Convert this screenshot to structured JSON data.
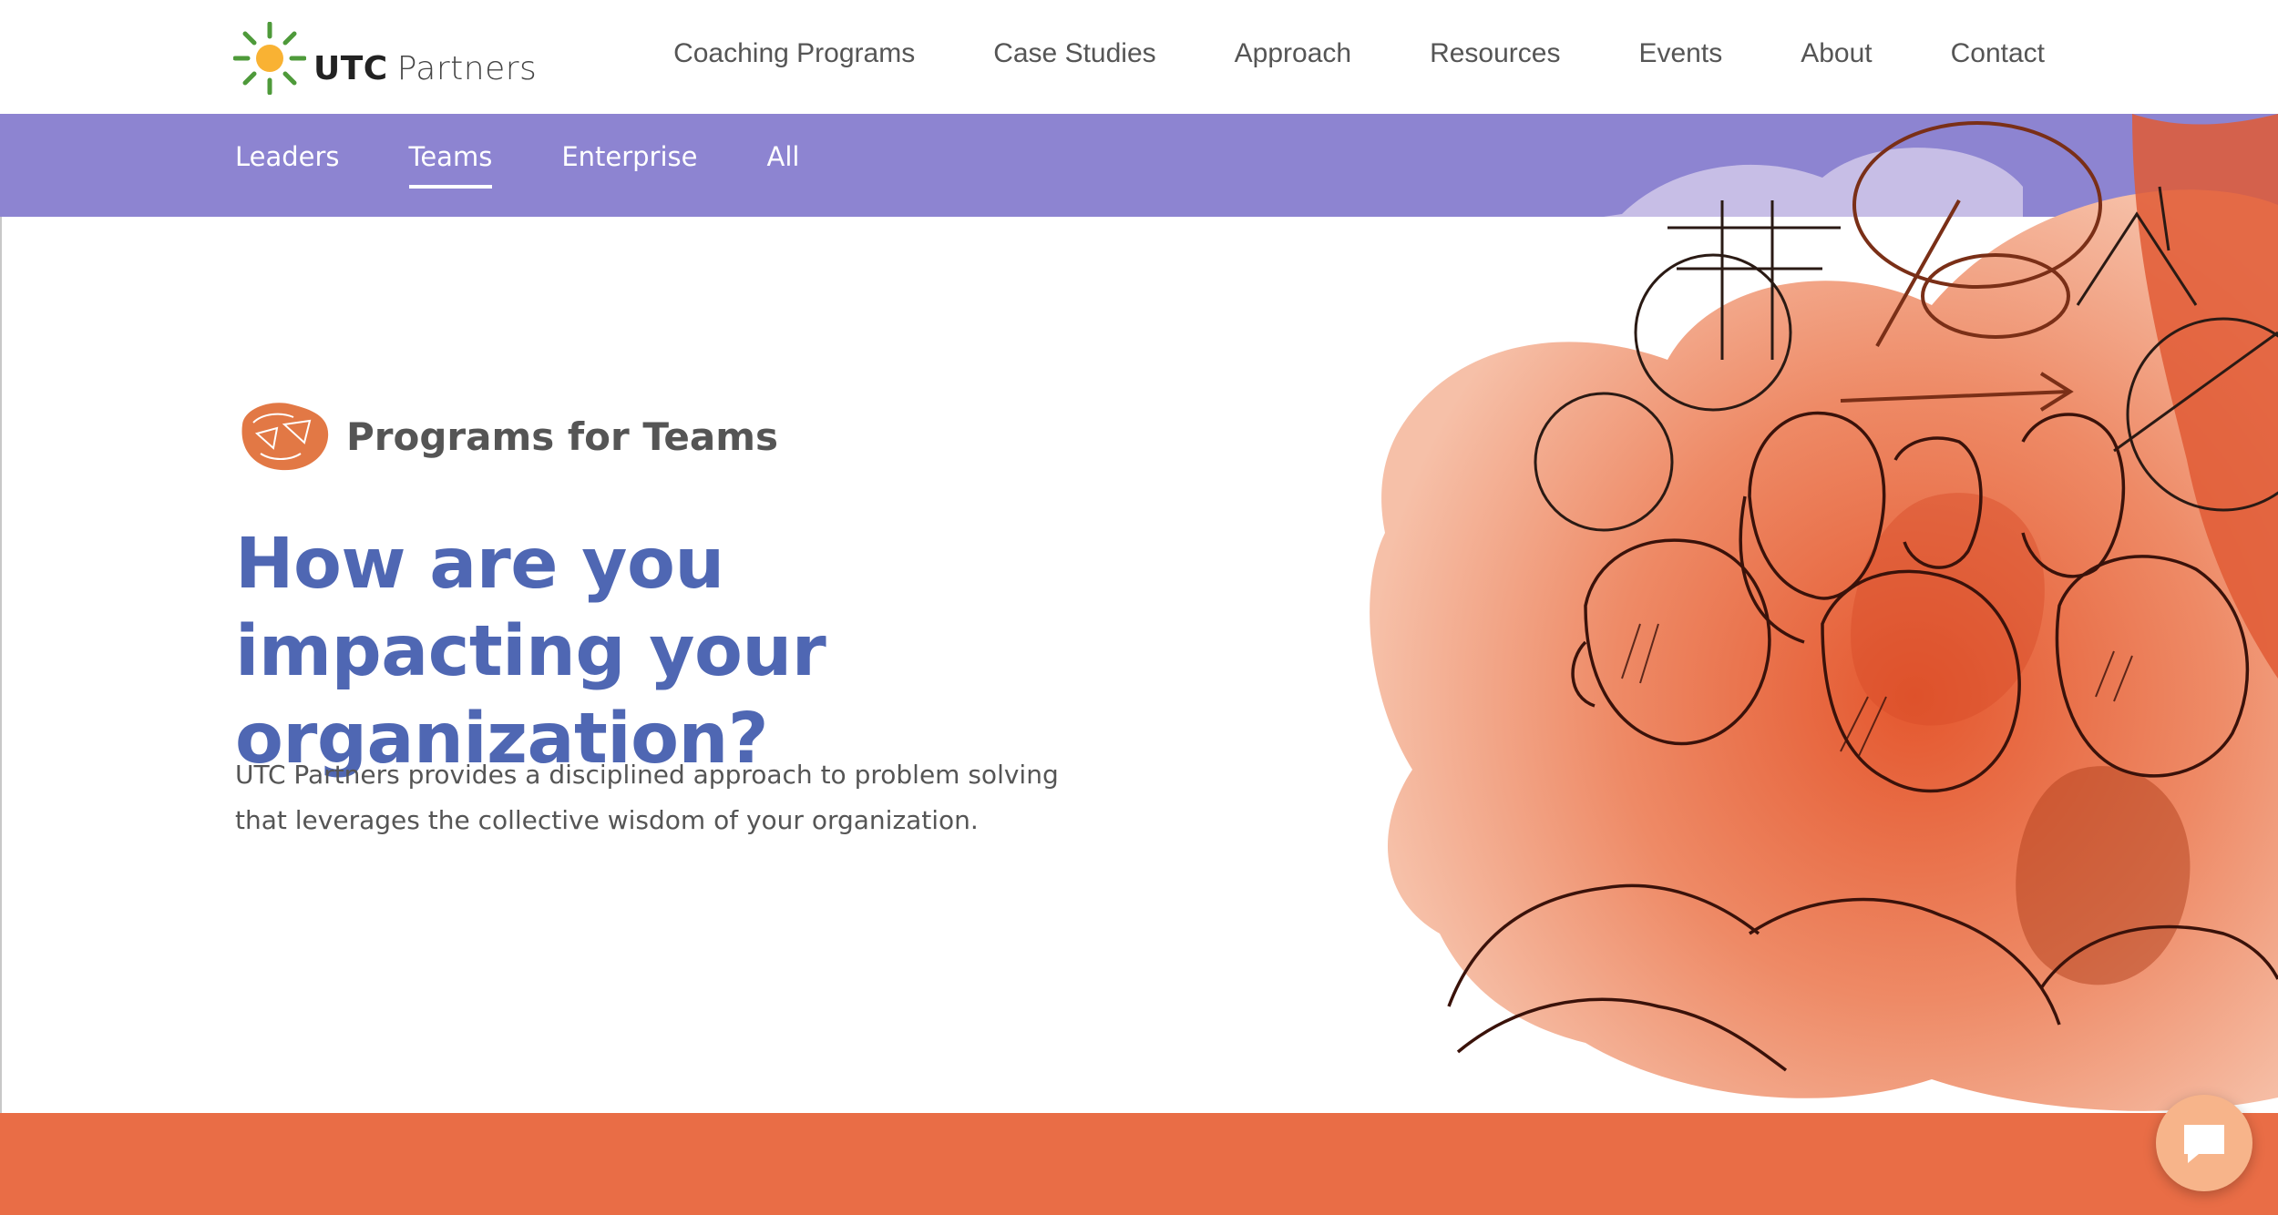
{
  "brand": {
    "logo_primary": "UTC",
    "logo_secondary": "Partners",
    "sun_color": "#f9b233",
    "ray_color": "#4e9a3a"
  },
  "main_nav": {
    "items": [
      {
        "label": "Coaching Programs"
      },
      {
        "label": "Case Studies"
      },
      {
        "label": "Approach"
      },
      {
        "label": "Resources"
      },
      {
        "label": "Events"
      },
      {
        "label": "About"
      },
      {
        "label": "Contact"
      }
    ]
  },
  "sub_nav": {
    "background": "#8d84d1",
    "active_index": 1,
    "items": [
      {
        "label": "Leaders"
      },
      {
        "label": "Teams"
      },
      {
        "label": "Enterprise"
      },
      {
        "label": "All"
      }
    ]
  },
  "hero": {
    "section_title": "Programs for Teams",
    "headline": "How are you impacting your organization?",
    "lead": "UTC Partners provides a disciplined approach to problem solving that leverages the collective wisdom of your organization.",
    "headline_color": "#4f67b3",
    "accent_color": "#e96d46",
    "illustration_icon": "team-sketch-illustration"
  },
  "chat": {
    "icon": "chat-bubble-icon"
  }
}
